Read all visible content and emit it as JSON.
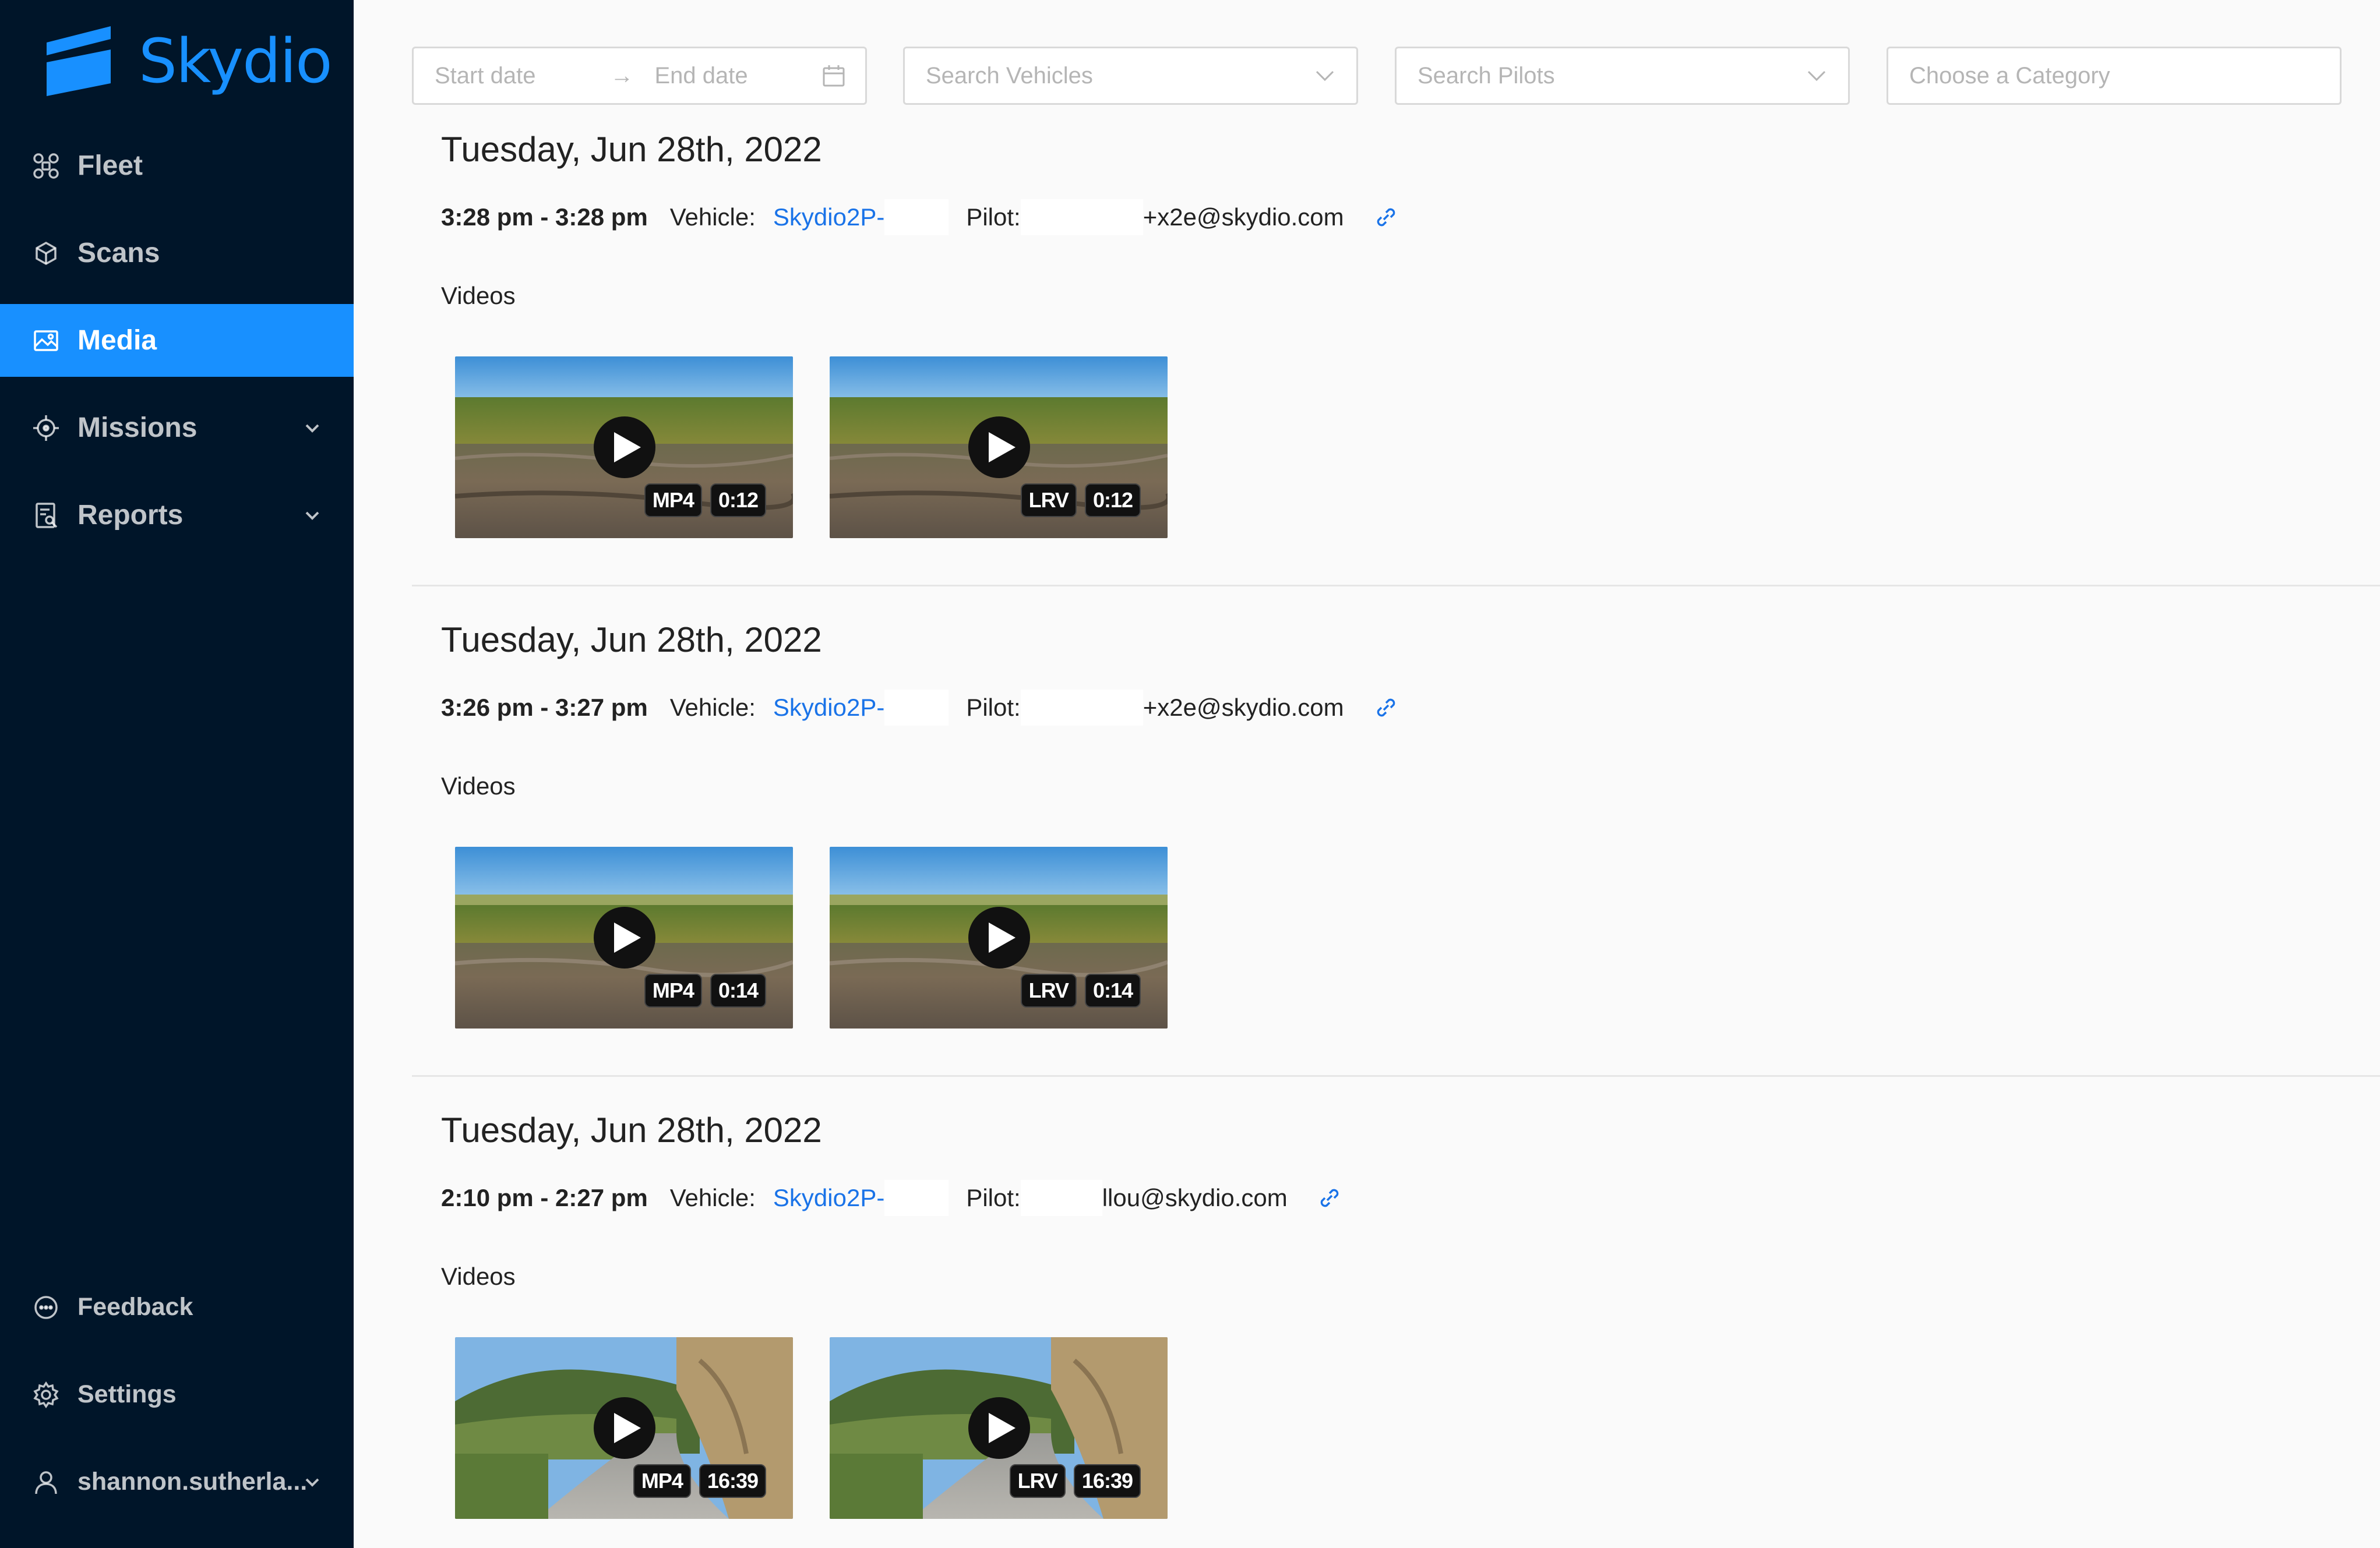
{
  "brand": {
    "name": "Skydio",
    "color": "#1890ff"
  },
  "sidebar": {
    "items": [
      {
        "label": "Fleet",
        "icon": "drone-icon"
      },
      {
        "label": "Scans",
        "icon": "scan-cube-icon"
      },
      {
        "label": "Media",
        "icon": "image-icon",
        "active": true
      },
      {
        "label": "Missions",
        "icon": "aim-icon",
        "expandable": true
      },
      {
        "label": "Reports",
        "icon": "report-icon",
        "expandable": true
      }
    ],
    "footer": [
      {
        "label": "Feedback",
        "icon": "comment-icon"
      },
      {
        "label": "Settings",
        "icon": "gear-icon"
      },
      {
        "label": "shannon.sutherla...",
        "icon": "user-icon",
        "expandable": true
      }
    ]
  },
  "filters": {
    "start_date": "Start date",
    "end_date": "End date",
    "vehicles": "Search Vehicles",
    "pilots": "Search Pilots",
    "category": "Choose a Category"
  },
  "flights": [
    {
      "date": "Tuesday, Jun 28th, 2022",
      "time": "3:28 pm - 3:28 pm",
      "vehicle_label": "Vehicle:",
      "vehicle": "Skydio2P-",
      "pilot_label": "Pilot:",
      "pilot": "+x2e@skydio.com",
      "videos_label": "Videos",
      "videos": [
        {
          "format": "MP4",
          "duration": "0:12"
        },
        {
          "format": "LRV",
          "duration": "0:12"
        }
      ]
    },
    {
      "date": "Tuesday, Jun 28th, 2022",
      "time": "3:26 pm - 3:27 pm",
      "vehicle_label": "Vehicle:",
      "vehicle": "Skydio2P-",
      "pilot_label": "Pilot:",
      "pilot": "+x2e@skydio.com",
      "videos_label": "Videos",
      "videos": [
        {
          "format": "MP4",
          "duration": "0:14"
        },
        {
          "format": "LRV",
          "duration": "0:14"
        }
      ]
    },
    {
      "date": "Tuesday, Jun 28th, 2022",
      "time": "2:10 pm - 2:27 pm",
      "vehicle_label": "Vehicle:",
      "vehicle": "Skydio2P-",
      "pilot_label": "Pilot:",
      "pilot": "llou@skydio.com",
      "videos_label": "Videos",
      "videos": [
        {
          "format": "MP4",
          "duration": "16:39"
        },
        {
          "format": "LRV",
          "duration": "16:39"
        }
      ]
    }
  ]
}
